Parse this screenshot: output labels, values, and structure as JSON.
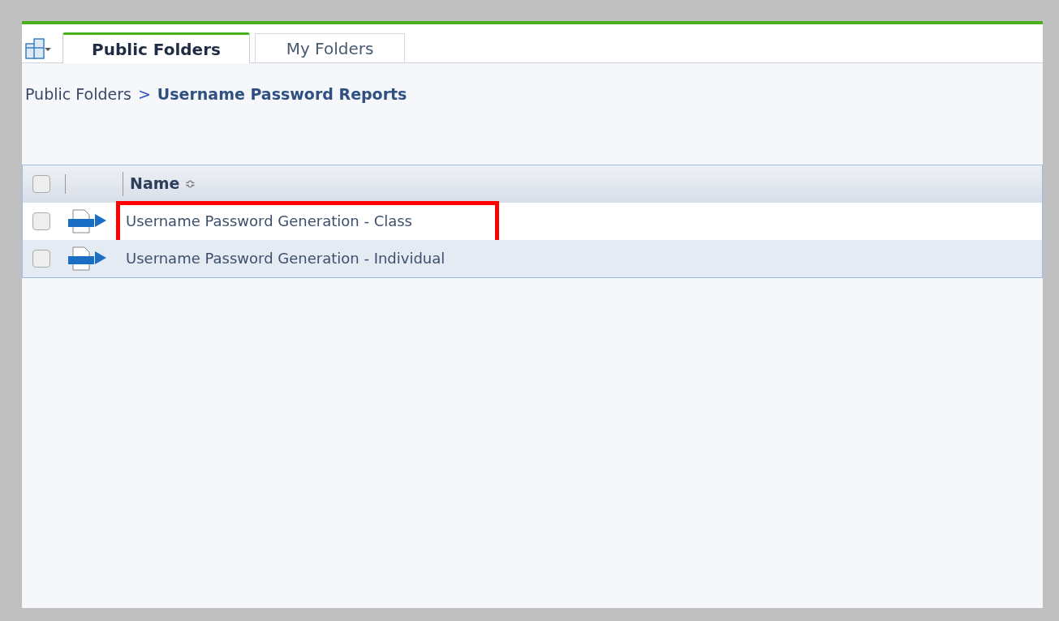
{
  "tabs": [
    {
      "label": "Public Folders",
      "selected": true
    },
    {
      "label": "My Folders",
      "selected": false
    }
  ],
  "breadcrumb": {
    "parent": "Public Folders",
    "separator": ">",
    "current": "Username Password Reports"
  },
  "table": {
    "header_checked": false,
    "columns": [
      {
        "label": "Name",
        "sort_icon": "≎"
      }
    ],
    "rows": [
      {
        "name": "Username Password Generation - Class",
        "checked": false,
        "highlighted": true
      },
      {
        "name": "Username Password Generation - Individual",
        "checked": false,
        "highlighted": false
      }
    ]
  }
}
